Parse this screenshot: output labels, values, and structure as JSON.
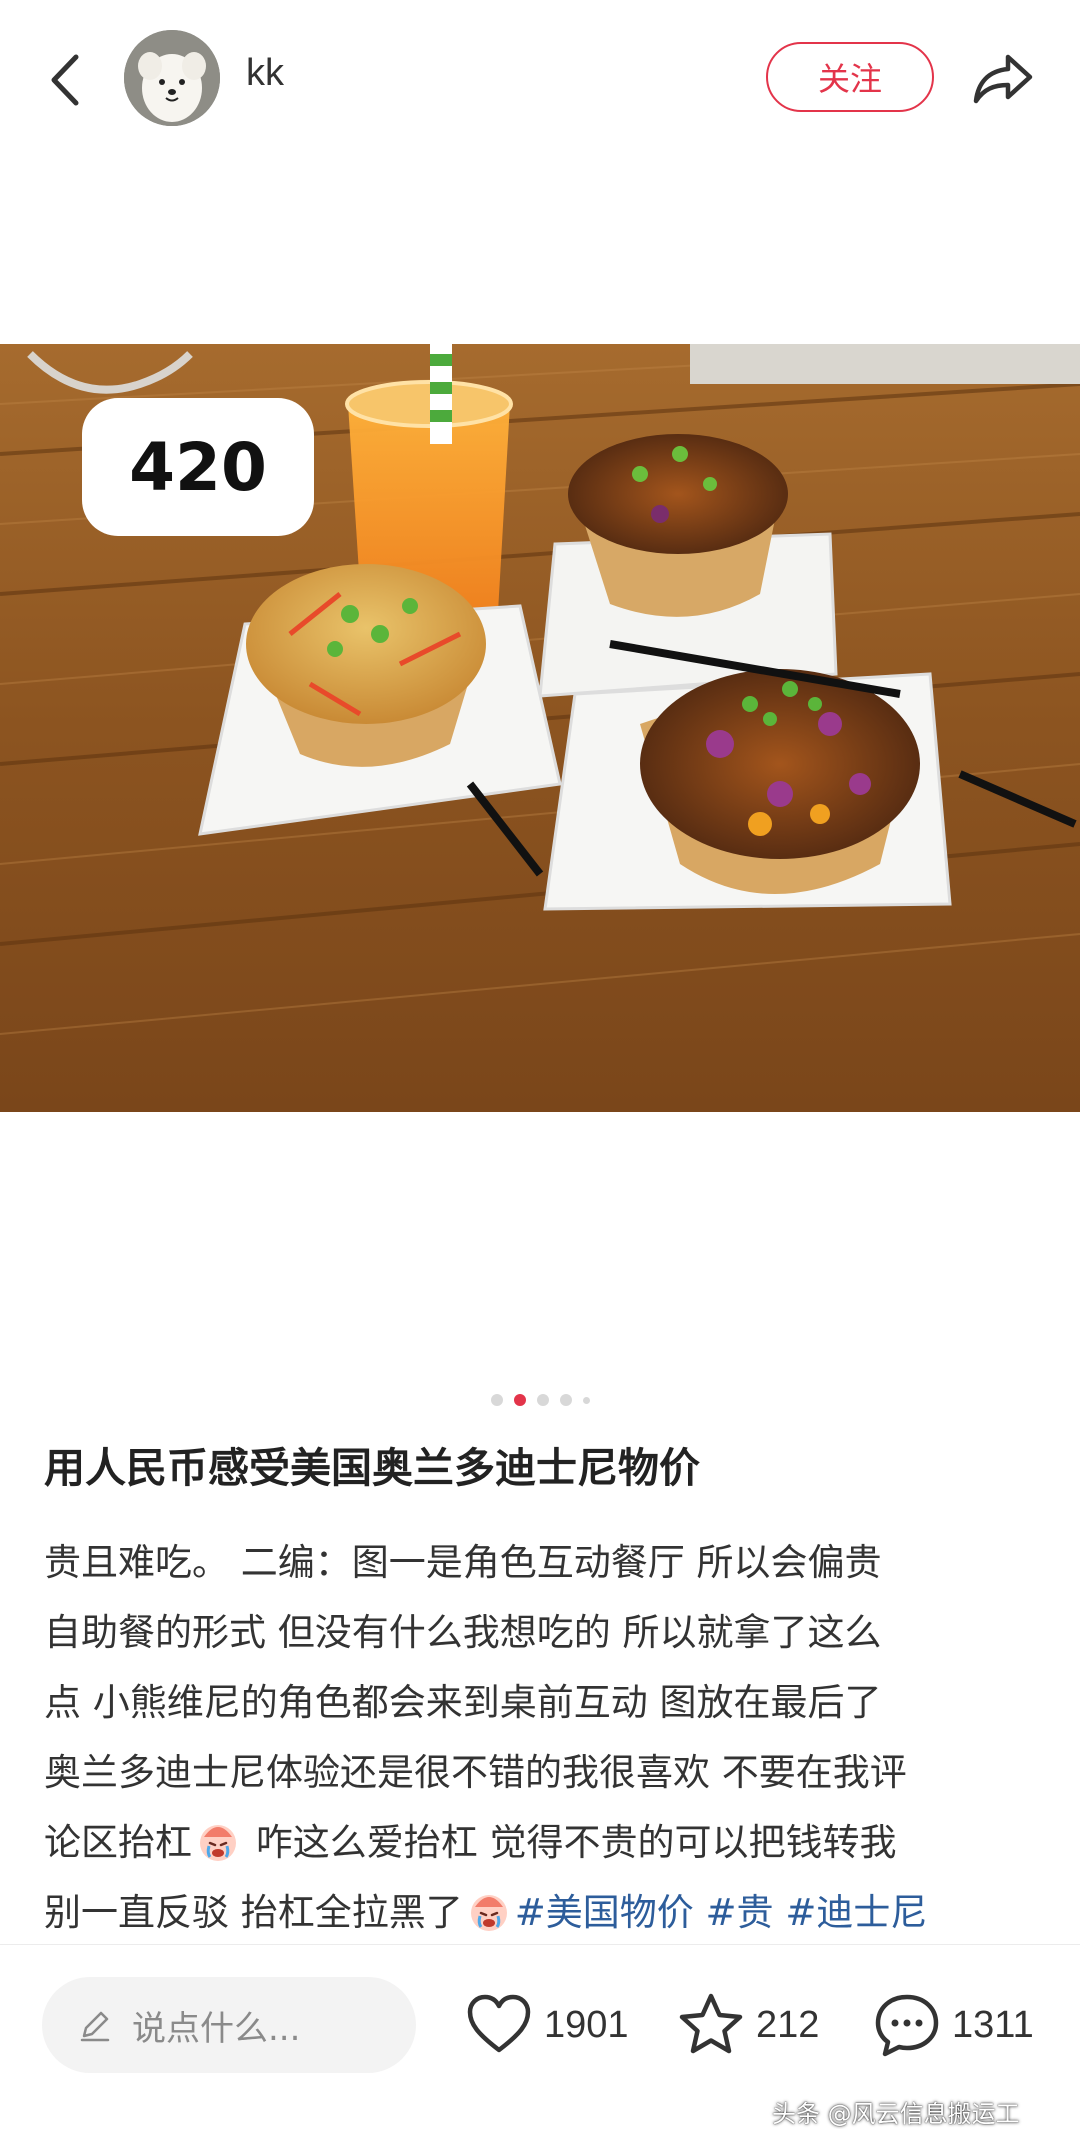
{
  "header": {
    "username": "kk",
    "follow_label": "关注"
  },
  "post": {
    "price_badge": "420",
    "image_count": 5,
    "active_image_index": 1,
    "title": "用人民币感受美国奥兰多迪士尼物价",
    "body_lines": [
      "贵且难吃。 二编：图一是角色互动餐厅 所以会偏贵",
      "自助餐的形式 但没有什么我想吃的 所以就拿了这么",
      "点 小熊维尼的角色都会来到桌前互动 图放在最后了",
      "奥兰多迪士尼体验还是很不错的我很喜欢 不要在我评"
    ],
    "body_line5_a": "论区抬杠",
    "body_line5_b": " 咋这么爱抬杠 觉得不贵的可以把钱转我",
    "body_line6_a": "别一直反驳 抬杠全拉黑了",
    "tags": [
      "#美国物价",
      "#贵",
      "#迪士尼"
    ],
    "emoji": "crying-face-icon"
  },
  "bottom_bar": {
    "comment_placeholder": "说点什么...",
    "likes": "1901",
    "favorites": "212",
    "comments": "1311"
  },
  "watermark": "头条 @风云信息搬运工",
  "colors": {
    "accent": "#e3344a",
    "tag": "#2d5d9b",
    "text": "#333333"
  },
  "icons": [
    "back-arrow-icon",
    "share-icon",
    "pen-icon",
    "heart-icon",
    "star-icon",
    "comment-bubble-icon"
  ]
}
